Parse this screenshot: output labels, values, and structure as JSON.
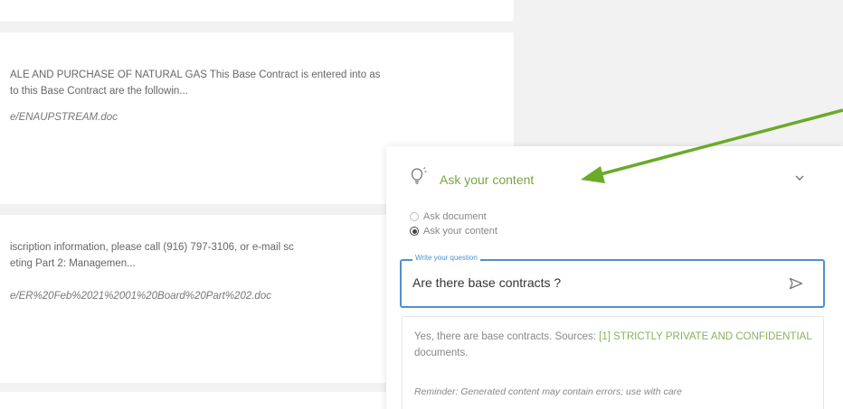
{
  "results": [
    {
      "snippet_1": "",
      "snippet_2": "",
      "path": ""
    },
    {
      "snippet_1": "ALE AND PURCHASE OF NATURAL GAS This Base Contract is entered into as",
      "snippet_2": "to this Base Contract are the followin...",
      "path": "e/ENAUPSTREAM.doc"
    },
    {
      "snippet_1": "iscription information, please call (916) 797-3106, or e-mail sc",
      "snippet_2": "eting Part 2: Managemen...",
      "path": "e/ER%20Feb%2021%2001%20Board%20Part%202.doc"
    }
  ],
  "panel": {
    "title": "Ask your content",
    "mode_document": "Ask document",
    "mode_content": "Ask your content",
    "selected_mode": "content",
    "question_label": "Write your question",
    "question_value": "Are there base contracts ?",
    "answer_prefix": "Yes, there are base contracts. Sources: ",
    "answer_link": "[1] STRICTLY PRIVATE AND CONFIDENTIAL",
    "answer_suffix": " documents.",
    "reminder": "Reminder: Generated content may contain errors; use with care"
  },
  "colors": {
    "accent_green": "#7aa442",
    "focus_blue": "#4f92c9",
    "annotation_arrow": "#6aaa28"
  },
  "icons": {
    "bulb": "lightbulb-icon",
    "chevron": "chevron-down-icon",
    "send": "send-icon"
  }
}
